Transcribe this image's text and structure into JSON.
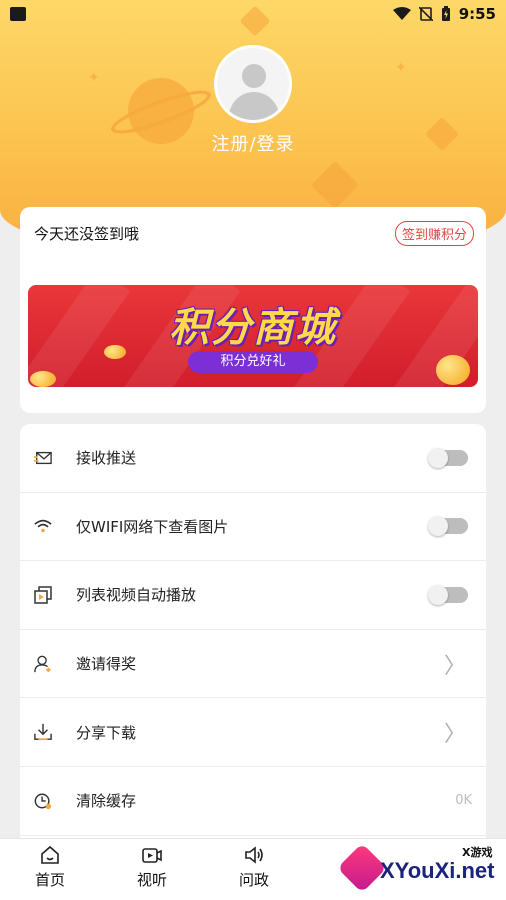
{
  "status_bar": {
    "time": "9:55"
  },
  "profile": {
    "login_label": "注册/登录"
  },
  "signin": {
    "prompt": "今天还没签到哦",
    "button_label": "签到赚积分",
    "banner_title": "积分商城",
    "banner_subtitle": "积分兑好礼"
  },
  "settings": {
    "items": [
      {
        "label": "接收推送",
        "icon": "push-mail-icon",
        "control": "toggle",
        "enabled": false
      },
      {
        "label": "仅WIFI网络下查看图片",
        "icon": "wifi-icon",
        "control": "toggle",
        "enabled": false
      },
      {
        "label": "列表视频自动播放",
        "icon": "video-autoplay-icon",
        "control": "toggle",
        "enabled": false
      },
      {
        "label": "邀请得奖",
        "icon": "invite-user-icon",
        "control": "chevron"
      },
      {
        "label": "分享下载",
        "icon": "download-icon",
        "control": "chevron"
      },
      {
        "label": "清除缓存",
        "icon": "clear-cache-icon",
        "control": "value",
        "value": "0K"
      }
    ]
  },
  "tabbar": {
    "tabs": [
      {
        "label": "首页",
        "icon": "home-icon"
      },
      {
        "label": "视听",
        "icon": "video-icon"
      },
      {
        "label": "问政",
        "icon": "speaker-icon"
      }
    ]
  },
  "watermark": {
    "brand": "XYouXi.net",
    "tag": "X游戏"
  }
}
